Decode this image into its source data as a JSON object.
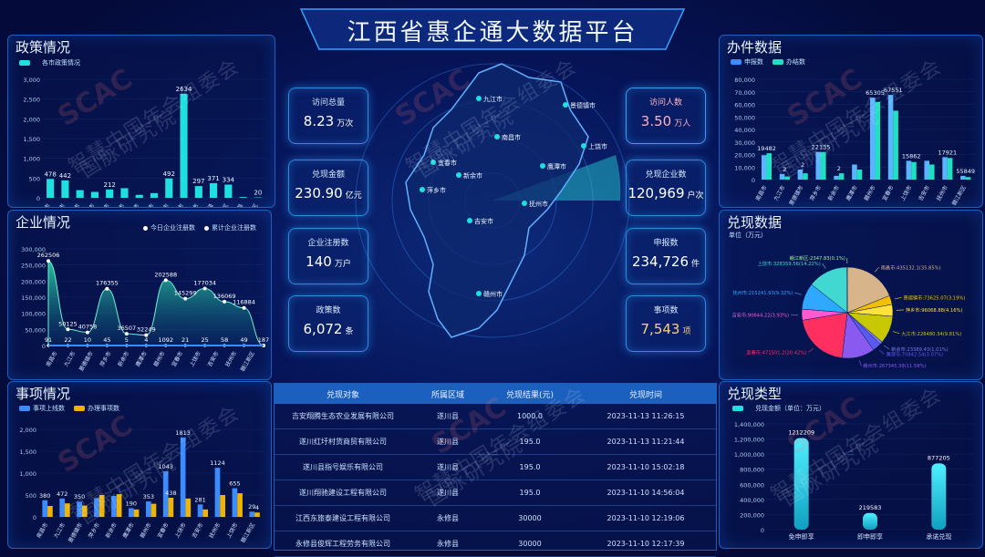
{
  "title": "江西省惠企通大数据平台",
  "policy": {
    "title": "政策情况",
    "legend": "各市政策情况",
    "yticks": [
      "3,000",
      "2,500",
      "2,000",
      "1,500",
      "1,000",
      "500",
      "0"
    ],
    "categories": [
      "南昌市",
      "九江市",
      "景德镇市",
      "萍乡市",
      "新余市",
      "鹰潭市",
      "赣州市",
      "宜春市",
      "上饶市",
      "吉安市",
      "抚州市",
      "省级",
      "赣江新区",
      "南昌县",
      "赣江新区"
    ],
    "values": [
      478,
      442,
      195,
      150,
      212,
      244,
      75,
      120,
      490,
      2634,
      297,
      371,
      334,
      20,
      10
    ],
    "labels": [
      "478",
      "442",
      "",
      "",
      "212",
      "",
      "",
      "",
      "492",
      "2634",
      "297",
      "371",
      "334",
      "",
      "20"
    ]
  },
  "enterprise": {
    "title": "企业情况",
    "legend1": "今日企业注册数",
    "legend2": "累计企业注册数",
    "yticks": [
      "300,000",
      "250,000",
      "200,000",
      "150,000",
      "100,000",
      "50,000",
      "0"
    ],
    "values": [
      262506,
      50125,
      40758,
      176355,
      36507,
      32249,
      202588,
      145299,
      177034,
      136069,
      116884,
      1
    ],
    "today": [
      "91",
      "22",
      "10",
      "45",
      "5",
      "4",
      "1092",
      "21",
      "25",
      "58",
      "49",
      "187"
    ],
    "labels": [
      "262506",
      "50125",
      "40758",
      "176355",
      "36507",
      "32249",
      "202588",
      "145299",
      "177034",
      "136069",
      "116884",
      ""
    ],
    "categories": [
      "南昌市",
      "九江市",
      "景德镇市",
      "萍乡市",
      "新余市",
      "鹰潭市",
      "赣州市",
      "宜春市",
      "上饶市",
      "吉安市",
      "抚州市",
      "赣江新区"
    ]
  },
  "items": {
    "title": "事项情况",
    "legend1": "事项上线数",
    "legend2": "办理事项数",
    "yticks": [
      "2,000",
      "1,500",
      "1,000",
      "500",
      "0"
    ],
    "series1": [
      380,
      420,
      350,
      430,
      480,
      200,
      353,
      1043,
      1813,
      285,
      1124,
      655,
      120
    ],
    "series2": [
      250,
      310,
      260,
      500,
      520,
      170,
      300,
      438,
      420,
      170,
      500,
      540,
      100
    ],
    "labels1": [
      "380",
      "472",
      "350",
      "",
      "",
      "190",
      "353",
      "1043",
      "1813",
      "281",
      "1124",
      "655",
      "29"
    ],
    "labels2": [
      "",
      "",
      "",
      "",
      "",
      "",
      "",
      "438",
      "",
      "",
      "",
      "",
      "4"
    ],
    "categories": [
      "南昌市",
      "九江市",
      "景德镇市",
      "萍乡市",
      "新余市",
      "鹰潭市",
      "赣州市",
      "宜春市",
      "上饶市",
      "吉安市",
      "抚州市",
      "上饶市",
      "赣江新区"
    ]
  },
  "kpis": [
    {
      "label": "访问总量",
      "value": "8.23",
      "unit": "万次",
      "style": ""
    },
    {
      "label": "兑现金额",
      "value": "230.90",
      "unit": "亿元",
      "style": ""
    },
    {
      "label": "企业注册数",
      "value": "140",
      "unit": "万户",
      "style": ""
    },
    {
      "label": "政策数",
      "value": "6,072",
      "unit": "条",
      "style": ""
    },
    {
      "label": "访问人数",
      "value": "3.50",
      "unit": "万人",
      "style": "warm"
    },
    {
      "label": "兑现企业数",
      "value": "120,969",
      "unit": "户次",
      "style": ""
    },
    {
      "label": "申报数",
      "value": "234,726",
      "unit": "件",
      "style": ""
    },
    {
      "label": "事项数",
      "value": "7,543",
      "unit": "项",
      "style": "gold"
    }
  ],
  "map": {
    "cities": [
      "九江市",
      "景德镇市",
      "南昌市",
      "上饶市",
      "宜春市",
      "鹰潭市",
      "新余市",
      "萍乡市",
      "抚州市",
      "吉安市",
      "赣州市"
    ]
  },
  "table": {
    "headers": [
      "兑现对象",
      "所属区域",
      "兑现结果(元)",
      "兑现时间"
    ],
    "rows": [
      [
        "吉安翔腾生态农业发展有限公司",
        "遂川县",
        "1000.0",
        "2023-11-13 11:26:15"
      ],
      [
        "遂川红圩村货商贸有限公司",
        "遂川县",
        "195.0",
        "2023-11-13 11:21:44"
      ],
      [
        "遂川县指号娱乐有限公司",
        "遂川县",
        "195.0",
        "2023-11-10 15:02:18"
      ],
      [
        "遂川翔驰建设工程有限公司",
        "遂川县",
        "195.0",
        "2023-11-10 14:56:04"
      ],
      [
        "江西东旅泰建设工程有限公司",
        "永修县",
        "30000",
        "2023-11-10 12:19:06"
      ],
      [
        "永修县俊辉工程劳务有限公司",
        "永修县",
        "30000",
        "2023-11-10 12:17:39"
      ]
    ]
  },
  "office": {
    "title": "办件数据",
    "legend1": "申报数",
    "legend2": "办结数",
    "yticks": [
      "80,000",
      "70,000",
      "60,000",
      "50,000",
      "40,000",
      "30,000",
      "20,000",
      "10,000",
      "0"
    ],
    "s1": [
      19482,
      4500,
      8000,
      22135,
      3000,
      12000,
      65305,
      67551,
      15000,
      15000,
      17921,
      3000
    ],
    "s2": [
      21000,
      2500,
      5000,
      22000,
      5000,
      8000,
      62000,
      55000,
      14000,
      12000,
      17216,
      2000
    ],
    "labels": [
      "19482",
      "2",
      "2",
      "22135",
      "2",
      "",
      "65305",
      "67551",
      "15862",
      "",
      "17921",
      "55849"
    ],
    "categories": [
      "南昌市",
      "九江市",
      "景德镇市",
      "萍乡市",
      "新余市",
      "鹰潭市",
      "赣州市",
      "宜春市",
      "上饶市",
      "吉安市",
      "抚州市",
      "赣江新区"
    ]
  },
  "cash": {
    "title": "兑现数据",
    "unit": "单位（万元）",
    "slices": [
      {
        "name": "南昌市",
        "value": 435132.1,
        "pct": "35.85%",
        "color": "#d7b48a"
      },
      {
        "name": "景德镇市",
        "value": 73625.07,
        "pct": "3.19%",
        "color": "#f0c000"
      },
      {
        "name": "萍乡市",
        "value": 96068.88,
        "pct": "4.16%",
        "color": "#ffe23a"
      },
      {
        "name": "九江市",
        "value": 226480.34,
        "pct": "9.81%",
        "color": "#c8c800"
      },
      {
        "name": "新余市",
        "value": 23389.43,
        "pct": "1.01%",
        "color": "#7a7af0"
      },
      {
        "name": "鹰潭市",
        "value": 70842.54,
        "pct": "3.07%",
        "color": "#5a5af0"
      },
      {
        "name": "赣州市",
        "value": 267345.39,
        "pct": "11.58%",
        "color": "#8a5af0"
      },
      {
        "name": "宜春市",
        "value": 471501.2,
        "pct": "20.42%",
        "color": "#ff3060"
      },
      {
        "name": "吉安市",
        "value": 90644.22,
        "pct": "3.93%",
        "color": "#ff5ad0"
      },
      {
        "name": "抚州市",
        "value": 215241.93,
        "pct": "9.32%",
        "color": "#30a8ff"
      },
      {
        "name": "上饶市",
        "value": 328359.56,
        "pct": "14.22%",
        "color": "#40d8d0"
      },
      {
        "name": "赣江新区",
        "value": 2347.83,
        "pct": "0.1%",
        "color": "#a0f0a0"
      }
    ],
    "labels": [
      "南昌市:435132.1(35.85%)",
      "景德镇市:73625.07(3.19%)",
      "萍乡市:96068.88(4.16%)",
      "九江市:226480.34(9.81%)",
      "新余市:23389.43(1.01%)",
      "鹰潭市:70842.54(3.07%)",
      "赣州市:267345.39(11.58%)",
      "宜春市:471501.2(20.42%)",
      "吉安市:90644.22(3.93%)",
      "抚州市:215241.93(9.32%)",
      "上饶市:328359.56(14.22%)",
      "赣江新区:2347.83(0.1%)"
    ]
  },
  "cashtype": {
    "title": "兑现类型",
    "legend": "兑现金额（单位：万元）",
    "yticks": [
      "1,400,000",
      "1,200,000",
      "1,000,000",
      "800,000",
      "600,000",
      "400,000",
      "200,000",
      "0"
    ],
    "categories": [
      "免申即享",
      "即申即享",
      "承诺兑现"
    ],
    "values": [
      1212209,
      219583,
      877205
    ],
    "labels": [
      "1212209",
      "219583",
      "877205"
    ]
  },
  "watermark": {
    "logo": "SCAC",
    "line1": "智慧中国年会组委会",
    "line2": "国脉研究院"
  },
  "colors": {
    "cyan": "#1fe0e0",
    "blue": "#3a8cff",
    "gold": "#f0b400",
    "panel_border": "#1d5fbf"
  }
}
